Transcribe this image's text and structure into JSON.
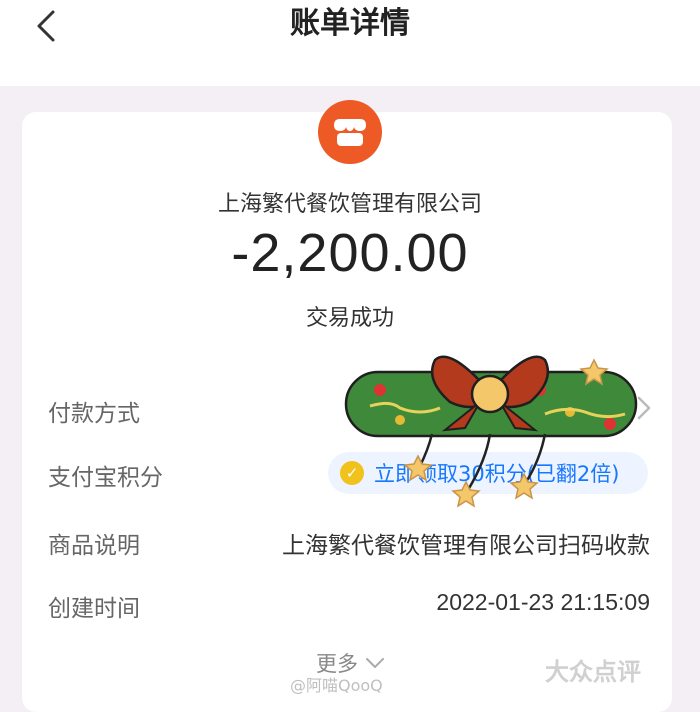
{
  "header": {
    "title": "账单详情"
  },
  "transaction": {
    "merchant": "上海繁代餐饮管理有限公司",
    "amount": "-2,200.00",
    "status": "交易成功"
  },
  "rows": {
    "payment_method": {
      "label": "付款方式"
    },
    "alipay_points": {
      "label": "支付宝积分",
      "value": "立即领取30积分(已翻2倍)"
    },
    "product_desc": {
      "label": "商品说明",
      "value": "上海繁代餐饮管理有限公司扫码收款"
    },
    "created_time": {
      "label": "创建时间",
      "value": "2022-01-23 21:15:09"
    }
  },
  "more": {
    "label": "更多"
  },
  "watermarks": {
    "weibo": "@阿喵QooQ",
    "brand": "大众点评"
  },
  "colors": {
    "accent": "#1677ff",
    "merchant_icon": "#ee5a26",
    "background": "#f4eff4"
  },
  "icons": [
    "chevron-left-icon",
    "store-icon",
    "chevron-right-icon",
    "points-coin-icon",
    "chevron-down-icon",
    "wreath-sticker"
  ]
}
